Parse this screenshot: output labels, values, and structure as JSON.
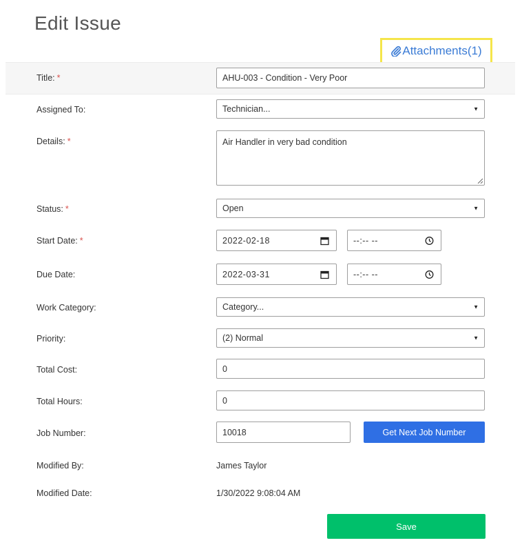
{
  "page": {
    "title": "Edit Issue",
    "attachments_label": "Attachments(1)"
  },
  "colors": {
    "accent_link": "#3a7bd5",
    "highlight_border": "#f5e54a",
    "required": "#d9534f",
    "primary_button": "#2f6fe4",
    "save_button": "#00c06b"
  },
  "icons": {
    "attachment": "paperclip-icon",
    "calendar": "calendar-icon",
    "clock": "clock-icon",
    "dropdown": "chevron-down-icon"
  },
  "form": {
    "required_marker": "*",
    "title": {
      "label": "Title:",
      "value": "AHU-003 - Condition - Very Poor"
    },
    "assigned_to": {
      "label": "Assigned To:",
      "value": "Technician..."
    },
    "details": {
      "label": "Details:",
      "value": "Air Handler in very bad condition"
    },
    "status": {
      "label": "Status:",
      "value": "Open"
    },
    "start_date": {
      "label": "Start Date:",
      "date": "2022-02-18",
      "time": "--:-- --"
    },
    "due_date": {
      "label": "Due Date:",
      "date": "2022-03-31",
      "time": "--:-- --"
    },
    "work_category": {
      "label": "Work Category:",
      "value": "Category..."
    },
    "priority": {
      "label": "Priority:",
      "value": "(2) Normal"
    },
    "total_cost": {
      "label": "Total Cost:",
      "value": "0"
    },
    "total_hours": {
      "label": "Total Hours:",
      "value": "0"
    },
    "job_number": {
      "label": "Job Number:",
      "value": "10018",
      "button_label": "Get Next Job Number"
    },
    "modified_by": {
      "label": "Modified By:",
      "value": "James Taylor"
    },
    "modified_date": {
      "label": "Modified Date:",
      "value": "1/30/2022 9:08:04 AM"
    }
  },
  "actions": {
    "save_label": "Save"
  }
}
